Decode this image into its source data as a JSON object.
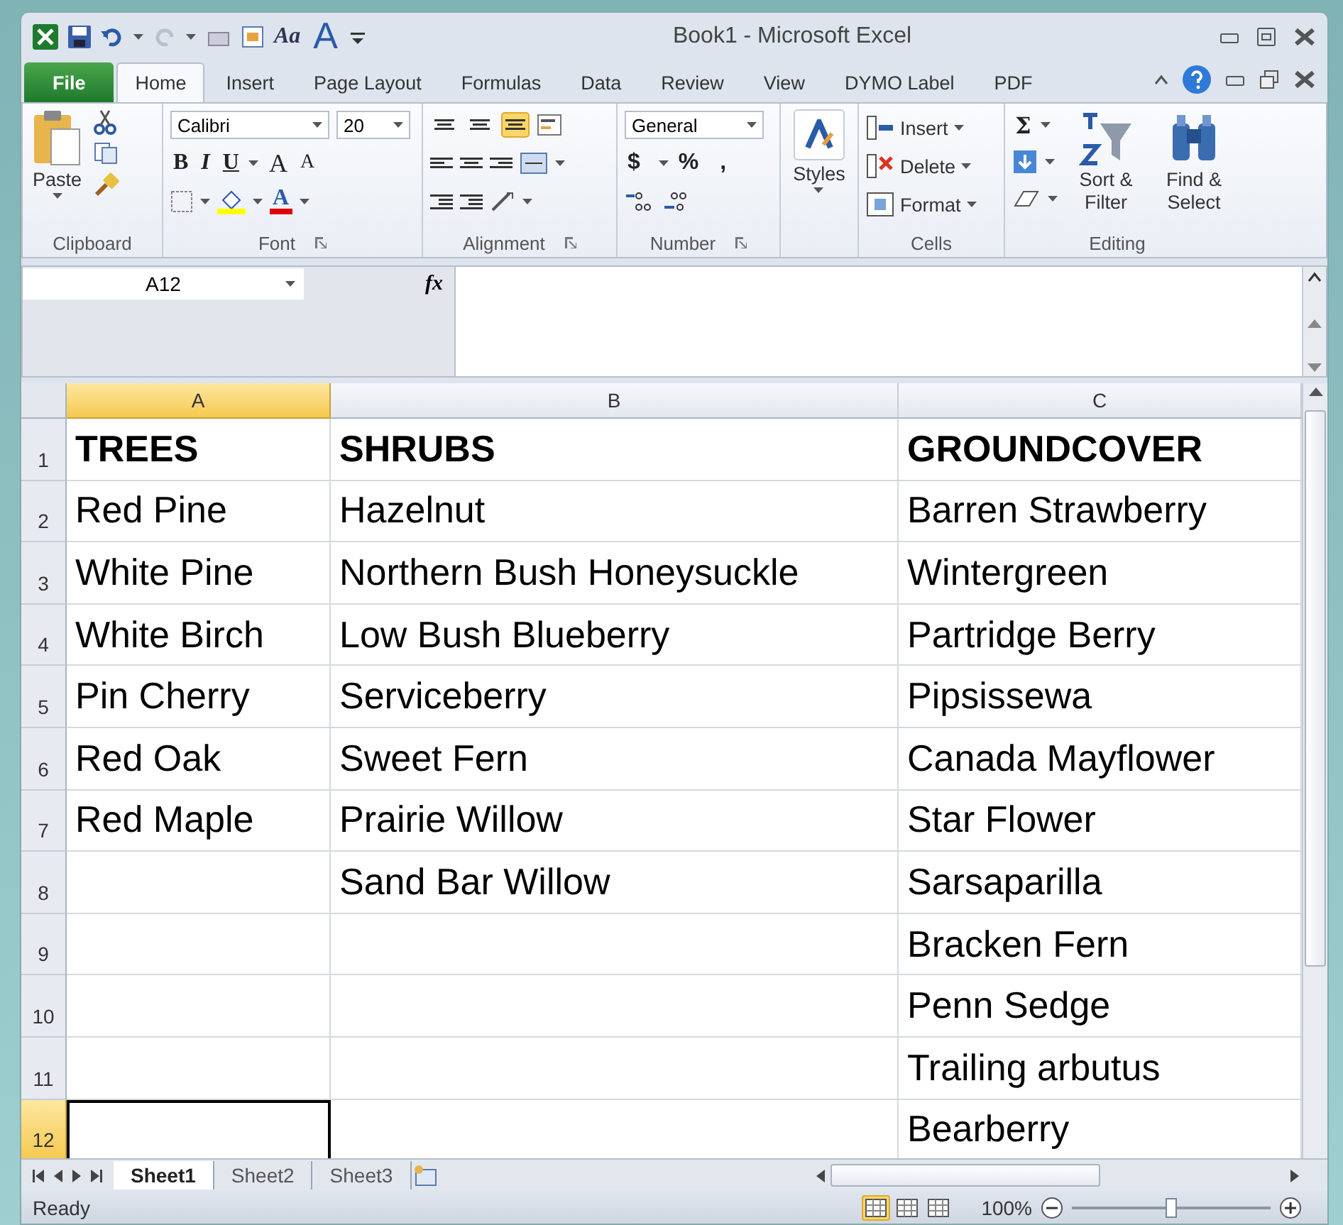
{
  "window": {
    "title": "Book1  -  Microsoft Excel"
  },
  "quick_access": {
    "glyphs": [
      "Aa",
      "A"
    ]
  },
  "file_tab": "File",
  "tabs": [
    {
      "label": "Home",
      "selected": true
    },
    {
      "label": "Insert",
      "selected": false
    },
    {
      "label": "Page Layout",
      "selected": false
    },
    {
      "label": "Formulas",
      "selected": false
    },
    {
      "label": "Data",
      "selected": false
    },
    {
      "label": "Review",
      "selected": false
    },
    {
      "label": "View",
      "selected": false
    },
    {
      "label": "DYMO Label",
      "selected": false
    },
    {
      "label": "PDF",
      "selected": false
    }
  ],
  "ribbon": {
    "clipboard": {
      "paste": "Paste",
      "label": "Clipboard"
    },
    "font": {
      "name": "Calibri",
      "size": "20",
      "style_buttons": [
        "B",
        "I",
        "U"
      ],
      "size_buttons": [
        "A",
        "A"
      ],
      "color_glyph": "A",
      "label": "Font"
    },
    "alignment": {
      "vertical": [
        {
          "selected": false
        },
        {
          "selected": false
        },
        {
          "selected": true
        }
      ],
      "label": "Alignment"
    },
    "number": {
      "format": "General",
      "symbols": [
        "$",
        "%",
        ","
      ],
      "label": "Number"
    },
    "styles": {
      "label": "Styles"
    },
    "cells": {
      "items": [
        "Insert",
        "Delete",
        "Format"
      ],
      "label": "Cells"
    },
    "editing": {
      "sum": "Σ",
      "sort": "Sort & Filter",
      "find": "Find & Select",
      "label": "Editing"
    }
  },
  "formula_bar": {
    "name_box": "A12",
    "function_label": "fx"
  },
  "sheet": {
    "columns": [
      {
        "label": "A",
        "selected": true
      },
      {
        "label": "B",
        "selected": false
      },
      {
        "label": "C",
        "selected": false
      }
    ],
    "rows": [
      {
        "number": "1",
        "selected": false,
        "bold": true,
        "cells": [
          {
            "text": "TREES",
            "selected": false
          },
          {
            "text": "SHRUBS",
            "selected": false
          },
          {
            "text": "GROUNDCOVER",
            "selected": false
          }
        ]
      },
      {
        "number": "2",
        "selected": false,
        "bold": false,
        "cells": [
          {
            "text": "Red Pine",
            "selected": false
          },
          {
            "text": "Hazelnut",
            "selected": false
          },
          {
            "text": "Barren Strawberry",
            "selected": false
          }
        ]
      },
      {
        "number": "3",
        "selected": false,
        "bold": false,
        "cells": [
          {
            "text": "White Pine",
            "selected": false
          },
          {
            "text": "Northern Bush Honeysuckle",
            "selected": false
          },
          {
            "text": "Wintergreen",
            "selected": false
          }
        ]
      },
      {
        "number": "4",
        "selected": false,
        "bold": false,
        "cells": [
          {
            "text": "White Birch",
            "selected": false
          },
          {
            "text": "Low Bush Blueberry",
            "selected": false
          },
          {
            "text": "Partridge Berry",
            "selected": false
          }
        ]
      },
      {
        "number": "5",
        "selected": false,
        "bold": false,
        "cells": [
          {
            "text": "Pin Cherry",
            "selected": false
          },
          {
            "text": "Serviceberry",
            "selected": false
          },
          {
            "text": "Pipsissewa",
            "selected": false
          }
        ]
      },
      {
        "number": "6",
        "selected": false,
        "bold": false,
        "cells": [
          {
            "text": "Red Oak",
            "selected": false
          },
          {
            "text": "Sweet Fern",
            "selected": false
          },
          {
            "text": "Canada Mayflower",
            "selected": false
          }
        ]
      },
      {
        "number": "7",
        "selected": false,
        "bold": false,
        "cells": [
          {
            "text": "Red Maple",
            "selected": false
          },
          {
            "text": "Prairie Willow",
            "selected": false
          },
          {
            "text": "Star Flower",
            "selected": false
          }
        ]
      },
      {
        "number": "8",
        "selected": false,
        "bold": false,
        "cells": [
          {
            "selected": false
          },
          {
            "text": "Sand Bar Willow",
            "selected": false
          },
          {
            "text": "Sarsaparilla",
            "selected": false
          }
        ]
      },
      {
        "number": "9",
        "selected": false,
        "bold": false,
        "cells": [
          {
            "selected": false
          },
          {
            "selected": false
          },
          {
            "text": "Bracken Fern",
            "selected": false
          }
        ]
      },
      {
        "number": "10",
        "selected": false,
        "bold": false,
        "cells": [
          {
            "selected": false
          },
          {
            "selected": false
          },
          {
            "text": "Penn Sedge",
            "selected": false
          }
        ]
      },
      {
        "number": "11",
        "selected": false,
        "bold": false,
        "cells": [
          {
            "selected": false
          },
          {
            "selected": false
          },
          {
            "text": "Trailing arbutus",
            "selected": false
          }
        ]
      },
      {
        "number": "12",
        "selected": true,
        "bold": false,
        "cells": [
          {
            "selected": true
          },
          {
            "selected": false
          },
          {
            "text": "Bearberry",
            "selected": false
          }
        ]
      }
    ]
  },
  "sheet_tabs": [
    {
      "label": "Sheet1",
      "selected": true
    },
    {
      "label": "Sheet2",
      "selected": false
    },
    {
      "label": "Sheet3",
      "selected": false
    }
  ],
  "status_bar": {
    "text": "Ready",
    "views": [
      {
        "selected": true
      },
      {
        "selected": false
      },
      {
        "selected": false
      }
    ],
    "zoom": "100%",
    "zoom_slider": {
      "level": 0.5
    }
  }
}
